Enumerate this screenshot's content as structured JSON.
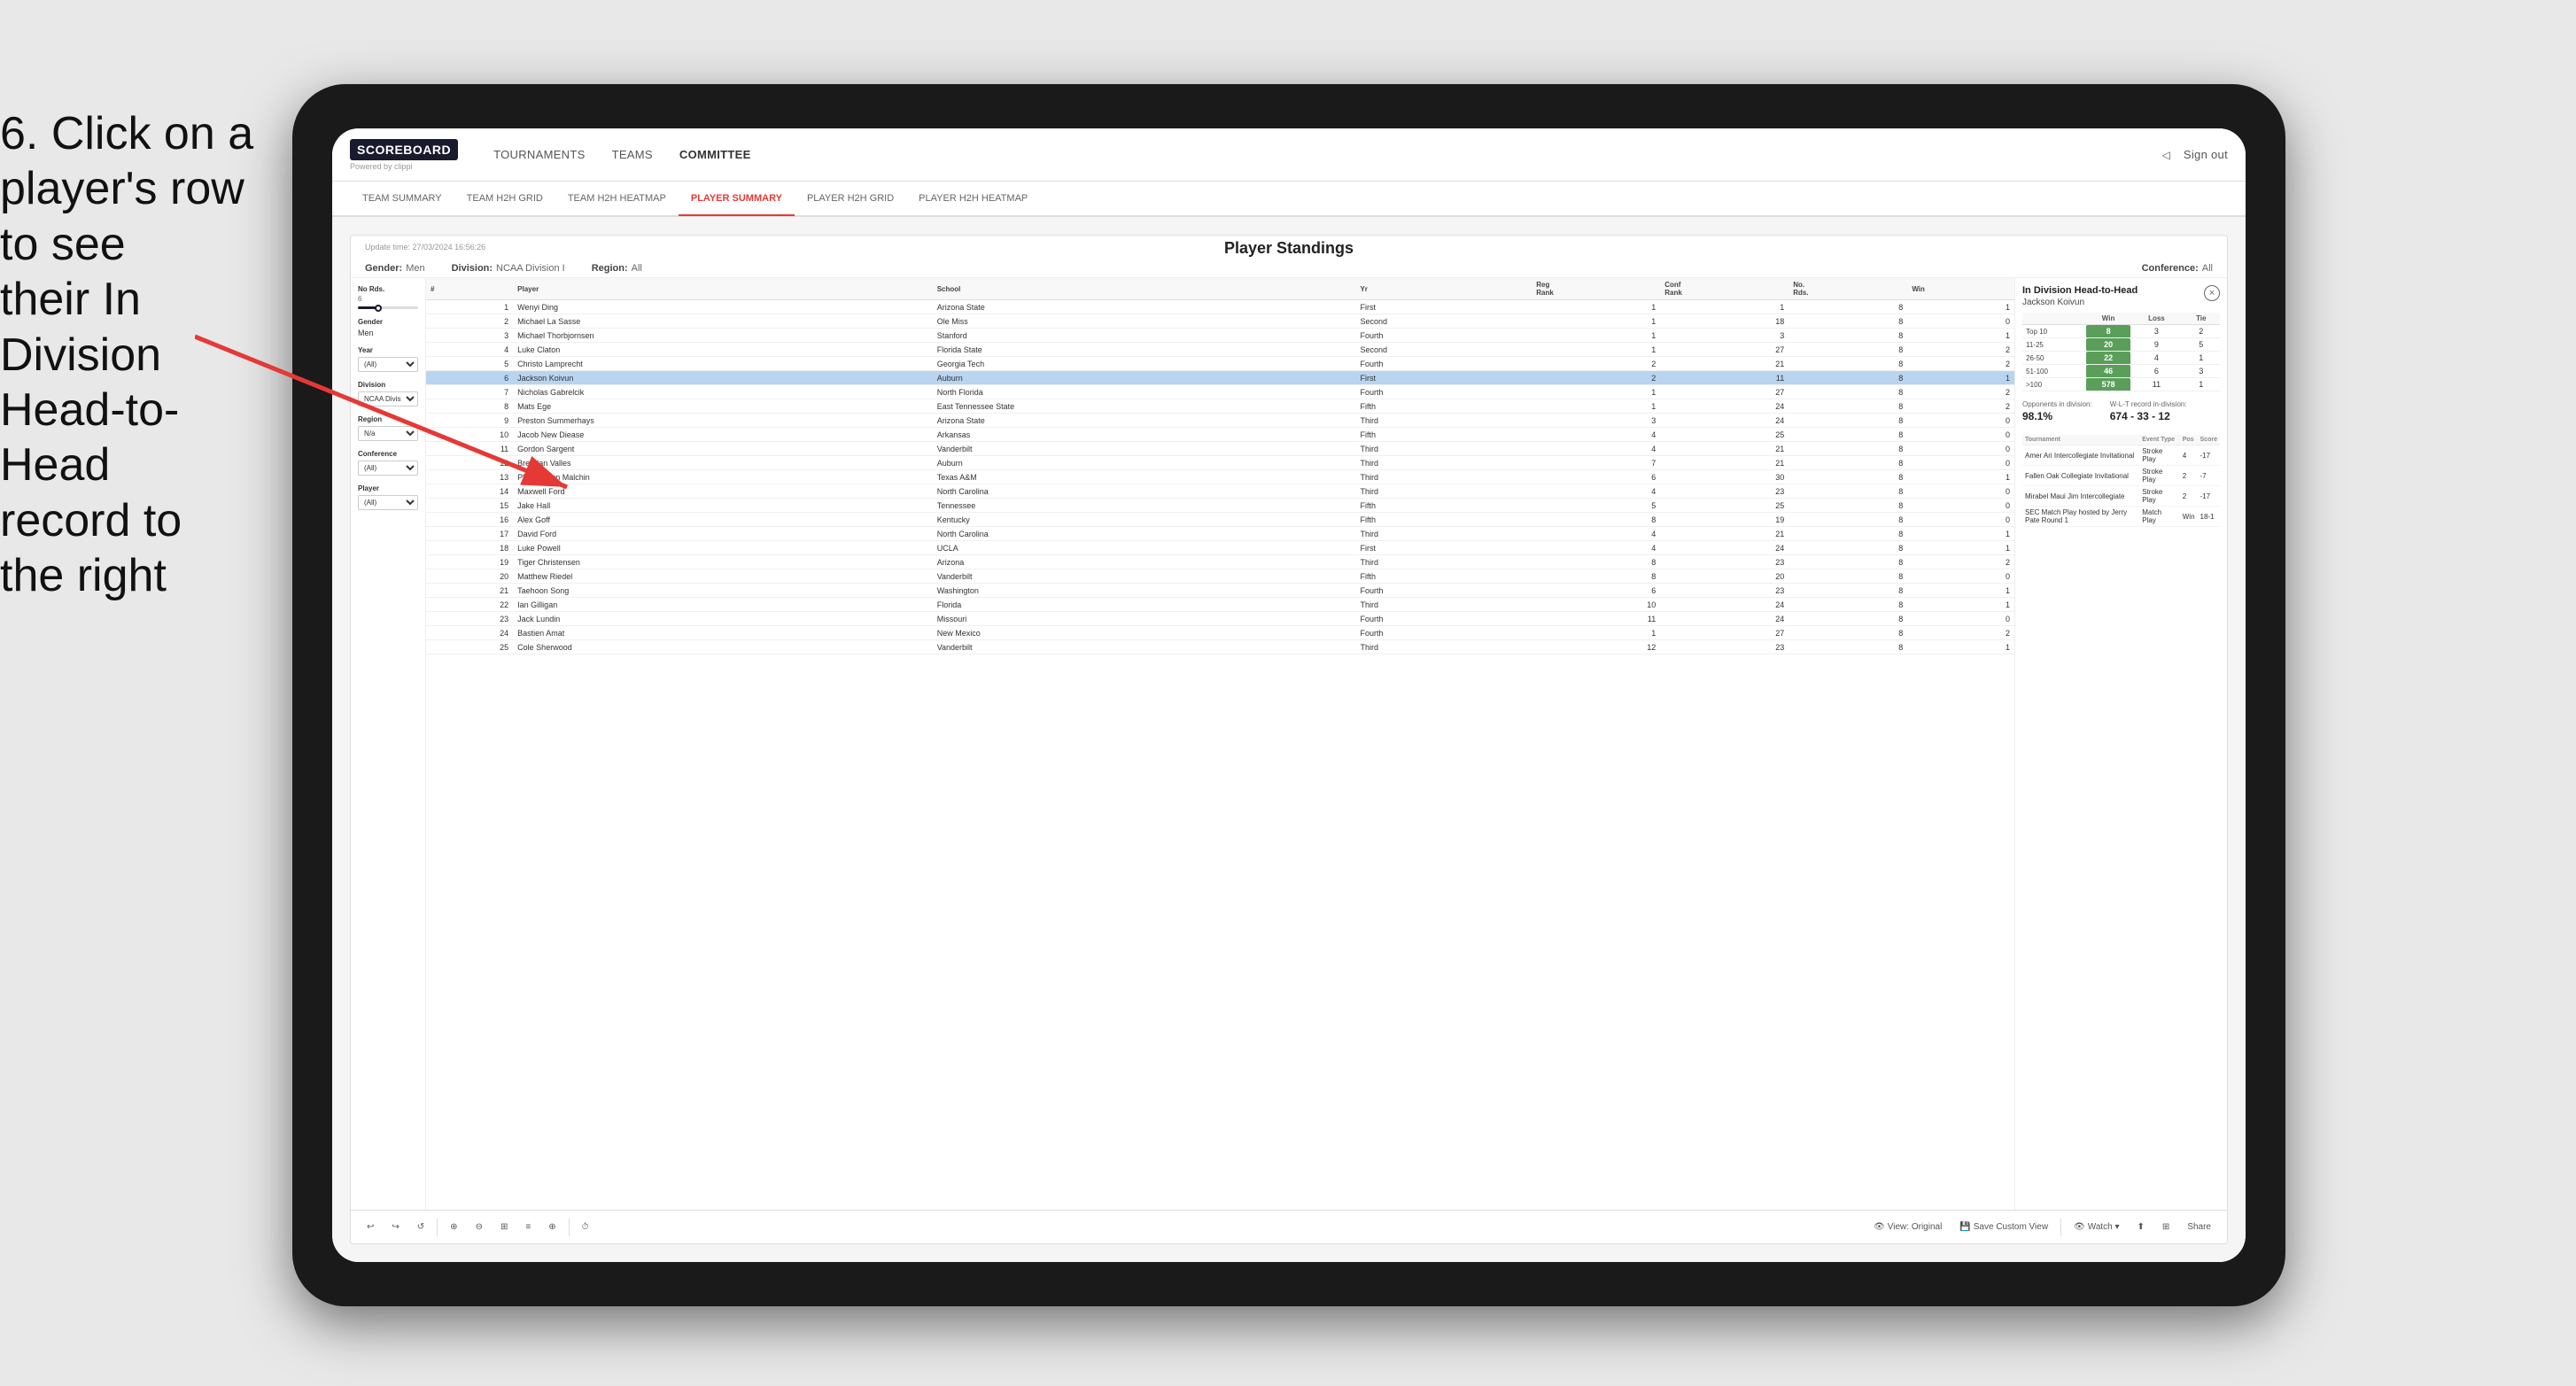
{
  "instruction": {
    "line1": "6. Click on a",
    "line2": "player's row to see",
    "line3": "their In Division",
    "line4": "Head-to-Head",
    "line5": "record to the right"
  },
  "topNav": {
    "logoText": "SCOREBOARD",
    "logoSub": "Powered by clippi",
    "items": [
      "TOURNAMENTS",
      "TEAMS",
      "COMMITTEE"
    ],
    "activeItem": "COMMITTEE",
    "rightItems": [
      "Sign out"
    ]
  },
  "subNav": {
    "items": [
      "TEAM SUMMARY",
      "TEAM H2H GRID",
      "TEAM H2H HEATMAP",
      "PLAYER SUMMARY",
      "PLAYER H2H GRID",
      "PLAYER H2H HEATMAP"
    ],
    "activeItem": "PLAYER SUMMARY"
  },
  "card": {
    "updateTime": "Update time:",
    "updateDate": "27/03/2024 16:56:26",
    "title": "Player Standings",
    "filters": [
      {
        "label": "Gender:",
        "value": "Men"
      },
      {
        "label": "Division:",
        "value": "NCAA Division I"
      },
      {
        "label": "Region:",
        "value": "All"
      },
      {
        "label": "Conference:",
        "value": "All"
      }
    ]
  },
  "filtersPanel": {
    "noRds": {
      "label": "No Rds.",
      "min": "6",
      "max": "...",
      "sliderPos": "30"
    },
    "gender": {
      "label": "Gender",
      "value": "Men"
    },
    "year": {
      "label": "Year",
      "value": "(All)"
    },
    "division": {
      "label": "Division",
      "value": "NCAA Division I"
    },
    "region": {
      "label": "Region",
      "value": "N/a"
    },
    "conference": {
      "label": "Conference",
      "value": "(All)"
    },
    "player": {
      "label": "Player",
      "value": "(All)"
    }
  },
  "tableHeaders": [
    "#",
    "Player",
    "School",
    "Yr",
    "Reg Rank",
    "Conf Rank",
    "No. Rds.",
    "Win"
  ],
  "tableRows": [
    {
      "num": 1,
      "player": "Wenyi Ding",
      "school": "Arizona State",
      "yr": "First",
      "reg": 1,
      "conf": 1,
      "rds": 8,
      "win": 1
    },
    {
      "num": 2,
      "player": "Michael La Sasse",
      "school": "Ole Miss",
      "yr": "Second",
      "reg": 1,
      "conf": 18,
      "rds": 8,
      "win": 0
    },
    {
      "num": 3,
      "player": "Michael Thorbjornsen",
      "school": "Stanford",
      "yr": "Fourth",
      "reg": 1,
      "conf": 3,
      "rds": 8,
      "win": 1
    },
    {
      "num": 4,
      "player": "Luke Claton",
      "school": "Florida State",
      "yr": "Second",
      "reg": 1,
      "conf": 27,
      "rds": 8,
      "win": 2
    },
    {
      "num": 5,
      "player": "Christo Lamprecht",
      "school": "Georgia Tech",
      "yr": "Fourth",
      "reg": 2,
      "conf": 21,
      "rds": 8,
      "win": 2
    },
    {
      "num": 6,
      "player": "Jackson Koivun",
      "school": "Auburn",
      "yr": "First",
      "reg": 2,
      "conf": 11,
      "rds": 8,
      "win": 1,
      "selected": true
    },
    {
      "num": 7,
      "player": "Nicholas Gabrelcik",
      "school": "North Florida",
      "yr": "Fourth",
      "reg": 1,
      "conf": 27,
      "rds": 8,
      "win": 2
    },
    {
      "num": 8,
      "player": "Mats Ege",
      "school": "East Tennessee State",
      "yr": "Fifth",
      "reg": 1,
      "conf": 24,
      "rds": 8,
      "win": 2
    },
    {
      "num": 9,
      "player": "Preston Summerhays",
      "school": "Arizona State",
      "yr": "Third",
      "reg": 3,
      "conf": 24,
      "rds": 8,
      "win": 0
    },
    {
      "num": 10,
      "player": "Jacob New Diease",
      "school": "Arkansas",
      "yr": "Fifth",
      "reg": 4,
      "conf": 25,
      "rds": 8,
      "win": 0
    },
    {
      "num": 11,
      "player": "Gordon Sargent",
      "school": "Vanderbilt",
      "yr": "Third",
      "reg": 4,
      "conf": 21,
      "rds": 8,
      "win": 0
    },
    {
      "num": 12,
      "player": "Brendan Valles",
      "school": "Auburn",
      "yr": "Third",
      "reg": 7,
      "conf": 21,
      "rds": 8,
      "win": 0
    },
    {
      "num": 13,
      "player": "Phachakorn Malchin",
      "school": "Texas A&M",
      "yr": "Third",
      "reg": 6,
      "conf": 30,
      "rds": 8,
      "win": 1
    },
    {
      "num": 14,
      "player": "Maxwell Ford",
      "school": "North Carolina",
      "yr": "Third",
      "reg": 4,
      "conf": 23,
      "rds": 8,
      "win": 0
    },
    {
      "num": 15,
      "player": "Jake Hall",
      "school": "Tennessee",
      "yr": "Fifth",
      "reg": 5,
      "conf": 25,
      "rds": 8,
      "win": 0
    },
    {
      "num": 16,
      "player": "Alex Goff",
      "school": "Kentucky",
      "yr": "Fifth",
      "reg": 8,
      "conf": 19,
      "rds": 8,
      "win": 0
    },
    {
      "num": 17,
      "player": "David Ford",
      "school": "North Carolina",
      "yr": "Third",
      "reg": 4,
      "conf": 21,
      "rds": 8,
      "win": 1
    },
    {
      "num": 18,
      "player": "Luke Powell",
      "school": "UCLA",
      "yr": "First",
      "reg": 4,
      "conf": 24,
      "rds": 8,
      "win": 1
    },
    {
      "num": 19,
      "player": "Tiger Christensen",
      "school": "Arizona",
      "yr": "Third",
      "reg": 8,
      "conf": 23,
      "rds": 8,
      "win": 2
    },
    {
      "num": 20,
      "player": "Matthew Riedel",
      "school": "Vanderbilt",
      "yr": "Fifth",
      "reg": 8,
      "conf": 20,
      "rds": 8,
      "win": 0
    },
    {
      "num": 21,
      "player": "Taehoon Song",
      "school": "Washington",
      "yr": "Fourth",
      "reg": 6,
      "conf": 23,
      "rds": 8,
      "win": 1
    },
    {
      "num": 22,
      "player": "Ian Gilligan",
      "school": "Florida",
      "yr": "Third",
      "reg": 10,
      "conf": 24,
      "rds": 8,
      "win": 1
    },
    {
      "num": 23,
      "player": "Jack Lundin",
      "school": "Missouri",
      "yr": "Fourth",
      "reg": 11,
      "conf": 24,
      "rds": 8,
      "win": 0
    },
    {
      "num": 24,
      "player": "Bastien Amat",
      "school": "New Mexico",
      "yr": "Fourth",
      "reg": 1,
      "conf": 27,
      "rds": 8,
      "win": 2
    },
    {
      "num": 25,
      "player": "Cole Sherwood",
      "school": "Vanderbilt",
      "yr": "Third",
      "reg": 12,
      "conf": 23,
      "rds": 8,
      "win": 1
    }
  ],
  "h2hPanel": {
    "title": "In Division Head-to-Head",
    "player": "Jackson Koivun",
    "closeLabel": "×",
    "headers": [
      "",
      "Win",
      "Loss",
      "Tie"
    ],
    "rows": [
      {
        "label": "Top 10",
        "win": 8,
        "loss": 3,
        "tie": 2
      },
      {
        "label": "11-25",
        "win": 20,
        "loss": 9,
        "tie": 5
      },
      {
        "label": "26-50",
        "win": 22,
        "loss": 4,
        "tie": 1
      },
      {
        "label": "51-100",
        "win": 46,
        "loss": 6,
        "tie": 3
      },
      {
        "label": ">100",
        "win": 578,
        "loss": 11,
        "tie": 1
      }
    ],
    "opponentsLabel": "Opponents in division:",
    "wltLabel": "W-L-T record in-division:",
    "opponents": "98.1%",
    "wlt": "674 - 33 - 12",
    "tournamentHeaders": [
      "Tournament",
      "Event Type",
      "Pos",
      "Score"
    ],
    "tournaments": [
      {
        "name": "Amer Ari Intercollegiate Invitational",
        "type": "Stroke Play",
        "pos": 4,
        "score": "-17"
      },
      {
        "name": "Fallen Oak Collegiate Invitational",
        "type": "Stroke Play",
        "pos": 2,
        "score": "-7"
      },
      {
        "name": "Mirabel Maui Jim Intercollegiate",
        "type": "Stroke Play",
        "pos": 2,
        "score": "-17"
      },
      {
        "name": "SEC Match Play hosted by Jerry Pate Round 1",
        "type": "Match Play",
        "pos": "Win",
        "score": "18-1"
      }
    ]
  },
  "toolbar": {
    "buttons": [
      "↩",
      "↩",
      "↩",
      "⊕",
      "⊕",
      "⊕",
      "≡",
      "⊕",
      "↻"
    ],
    "viewOriginal": "View: Original",
    "saveCustomView": "Save Custom View",
    "watch": "Watch ▾",
    "share": "Share"
  }
}
